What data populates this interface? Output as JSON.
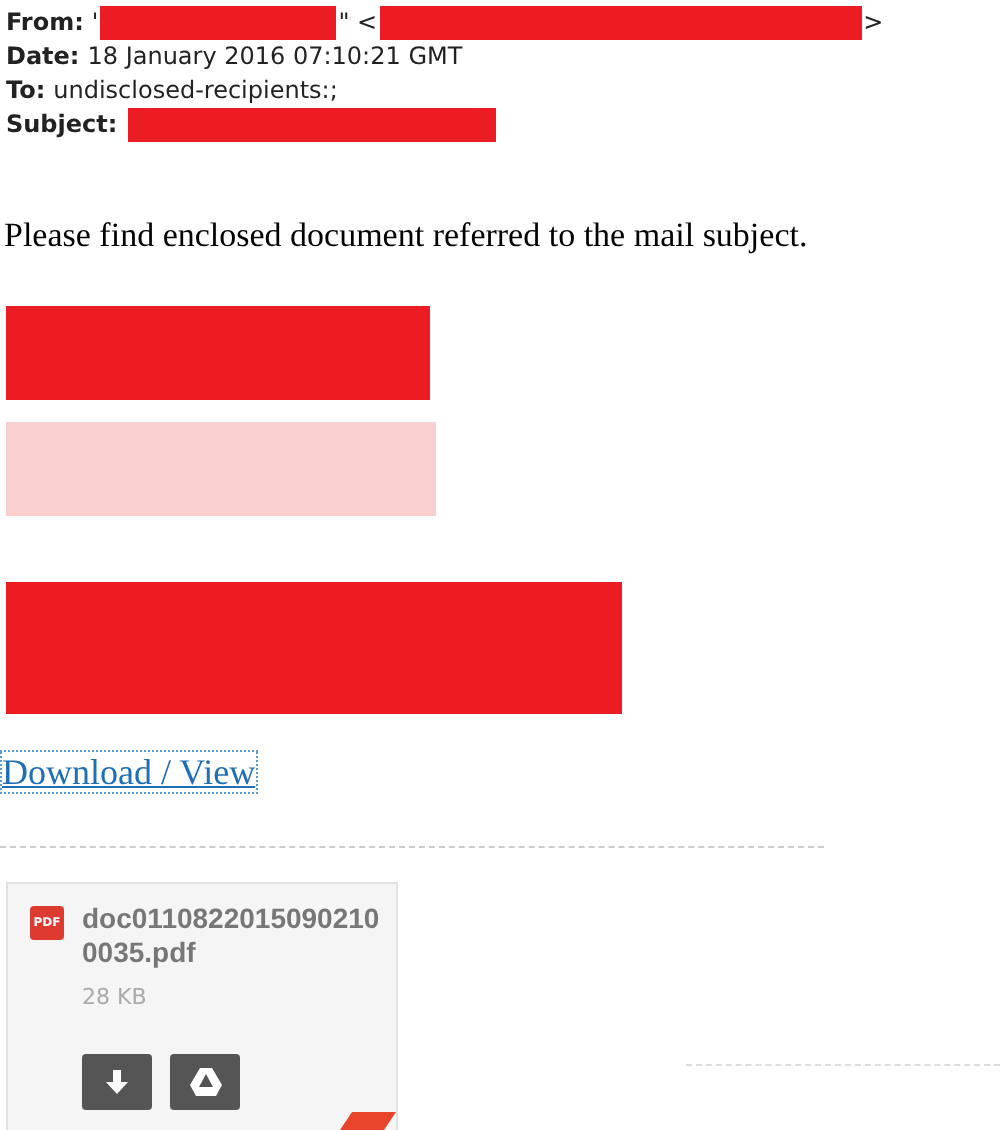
{
  "header": [
    {
      "label": "From:",
      "parts": [
        {
          "kind": "text",
          "text": "'"
        },
        {
          "kind": "redaction_short"
        },
        {
          "kind": "text",
          "text": "\" <"
        },
        {
          "kind": "redaction_long"
        },
        {
          "kind": "text",
          "text": ">"
        }
      ]
    },
    {
      "label": "Date:",
      "parts": [
        {
          "kind": "text",
          "text": "18 January 2016 07:10:21 GMT"
        }
      ]
    },
    {
      "label": "To:",
      "parts": [
        {
          "kind": "text",
          "text": "undisclosed-recipients:;"
        }
      ]
    },
    {
      "label": "Subject:",
      "parts": [
        {
          "kind": "redaction_medium"
        }
      ]
    }
  ],
  "body": {
    "text": "Please find enclosed document referred to the mail subject.",
    "blocks": [
      {
        "kind": "redaction"
      },
      {
        "kind": "faded_redaction"
      },
      {
        "kind": "redaction_large"
      }
    ],
    "link": "Download / View"
  },
  "attachment": {
    "type_label": "PDF",
    "filename": "doc01108220150902100035.pdf",
    "size": "28 KB"
  }
}
